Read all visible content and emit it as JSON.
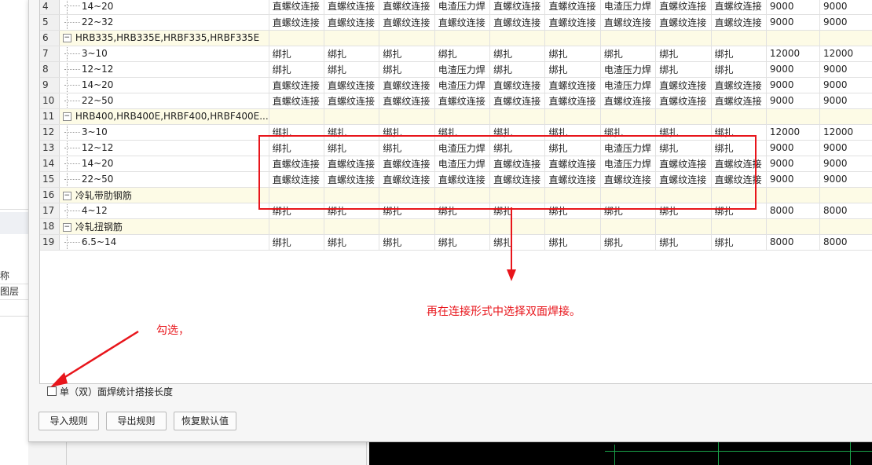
{
  "background": {
    "left_labels": [
      "称",
      "图层"
    ]
  },
  "table": {
    "columns": 12,
    "rows": [
      {
        "num": "4",
        "type": "sub",
        "label": "14~20",
        "values": [
          "直螺纹连接",
          "直螺纹连接",
          "直螺纹连接",
          "电渣压力焊",
          "直螺纹连接",
          "直螺纹连接",
          "电渣压力焊",
          "直螺纹连接",
          "直螺纹连接",
          "9000",
          "9000"
        ]
      },
      {
        "num": "5",
        "type": "sub",
        "label": "22~32",
        "values": [
          "直螺纹连接",
          "直螺纹连接",
          "直螺纹连接",
          "直螺纹连接",
          "直螺纹连接",
          "直螺纹连接",
          "直螺纹连接",
          "直螺纹连接",
          "直螺纹连接",
          "9000",
          "9000"
        ]
      },
      {
        "num": "6",
        "type": "group",
        "label": "HRB335,HRB335E,HRBF335,HRBF335E",
        "values": []
      },
      {
        "num": "7",
        "type": "sub",
        "label": "3~10",
        "values": [
          "绑扎",
          "绑扎",
          "绑扎",
          "绑扎",
          "绑扎",
          "绑扎",
          "绑扎",
          "绑扎",
          "绑扎",
          "12000",
          "12000"
        ]
      },
      {
        "num": "8",
        "type": "sub",
        "label": "12~12",
        "values": [
          "绑扎",
          "绑扎",
          "绑扎",
          "电渣压力焊",
          "绑扎",
          "绑扎",
          "电渣压力焊",
          "绑扎",
          "绑扎",
          "9000",
          "9000"
        ]
      },
      {
        "num": "9",
        "type": "sub",
        "label": "14~20",
        "values": [
          "直螺纹连接",
          "直螺纹连接",
          "直螺纹连接",
          "电渣压力焊",
          "直螺纹连接",
          "直螺纹连接",
          "电渣压力焊",
          "直螺纹连接",
          "直螺纹连接",
          "9000",
          "9000"
        ]
      },
      {
        "num": "10",
        "type": "sub",
        "label": "22~50",
        "values": [
          "直螺纹连接",
          "直螺纹连接",
          "直螺纹连接",
          "直螺纹连接",
          "直螺纹连接",
          "直螺纹连接",
          "直螺纹连接",
          "直螺纹连接",
          "直螺纹连接",
          "9000",
          "9000"
        ]
      },
      {
        "num": "11",
        "type": "group",
        "label": "HRB400,HRB400E,HRBF400,HRBF400E...",
        "values": []
      },
      {
        "num": "12",
        "type": "sub",
        "label": "3~10",
        "values": [
          "绑扎",
          "绑扎",
          "绑扎",
          "绑扎",
          "绑扎",
          "绑扎",
          "绑扎",
          "绑扎",
          "绑扎",
          "12000",
          "12000"
        ]
      },
      {
        "num": "13",
        "type": "sub",
        "label": "12~12",
        "values": [
          "绑扎",
          "绑扎",
          "绑扎",
          "电渣压力焊",
          "绑扎",
          "绑扎",
          "电渣压力焊",
          "绑扎",
          "绑扎",
          "9000",
          "9000"
        ]
      },
      {
        "num": "14",
        "type": "sub",
        "label": "14~20",
        "values": [
          "直螺纹连接",
          "直螺纹连接",
          "直螺纹连接",
          "电渣压力焊",
          "直螺纹连接",
          "直螺纹连接",
          "电渣压力焊",
          "直螺纹连接",
          "直螺纹连接",
          "9000",
          "9000"
        ]
      },
      {
        "num": "15",
        "type": "sub",
        "label": "22~50",
        "values": [
          "直螺纹连接",
          "直螺纹连接",
          "直螺纹连接",
          "直螺纹连接",
          "直螺纹连接",
          "直螺纹连接",
          "直螺纹连接",
          "直螺纹连接",
          "直螺纹连接",
          "9000",
          "9000"
        ]
      },
      {
        "num": "16",
        "type": "group",
        "label": "冷轧带肋钢筋",
        "values": []
      },
      {
        "num": "17",
        "type": "sub",
        "label": "4~12",
        "values": [
          "绑扎",
          "绑扎",
          "绑扎",
          "绑扎",
          "绑扎",
          "绑扎",
          "绑扎",
          "绑扎",
          "绑扎",
          "8000",
          "8000"
        ]
      },
      {
        "num": "18",
        "type": "group",
        "label": "冷轧扭钢筋",
        "values": []
      },
      {
        "num": "19",
        "type": "sub",
        "label": "6.5~14",
        "values": [
          "绑扎",
          "绑扎",
          "绑扎",
          "绑扎",
          "绑扎",
          "绑扎",
          "绑扎",
          "绑扎",
          "绑扎",
          "8000",
          "8000"
        ]
      }
    ]
  },
  "annotations": {
    "select_text": "再在连接形式中选择双面焊接。",
    "check_text": "勾选，"
  },
  "options": {
    "checkbox_label": "单（双）面焊统计搭接长度",
    "checked": false
  },
  "buttons": {
    "import": "导入规则",
    "export": "导出规则",
    "restore": "恢复默认值"
  },
  "colors": {
    "annotation_red": "#e8151b",
    "group_row_bg": "#fdfbe6",
    "cad_line_green": "#1aa34a"
  }
}
